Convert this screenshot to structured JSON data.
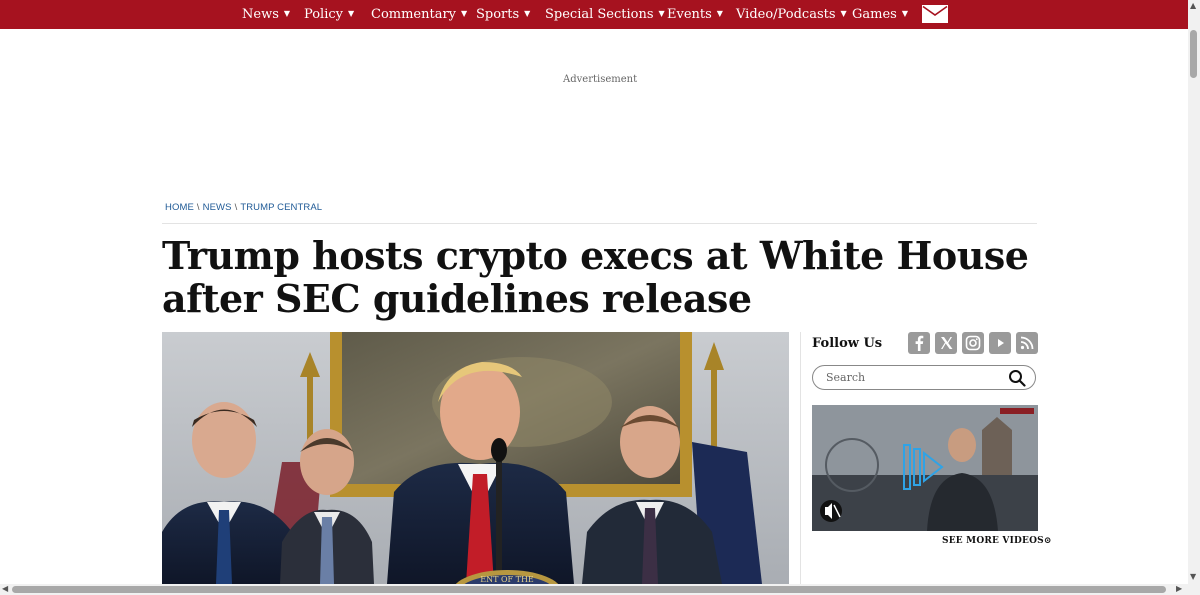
{
  "nav": {
    "items": [
      {
        "label": "News"
      },
      {
        "label": "Policy"
      },
      {
        "label": "Commentary"
      },
      {
        "label": "Sports"
      },
      {
        "label": "Special Sections"
      },
      {
        "label": "Events"
      },
      {
        "label": "Video/Podcasts"
      },
      {
        "label": "Games"
      }
    ],
    "mail_icon": "envelope-icon",
    "bg_color": "#a6121f"
  },
  "ad": {
    "label": "Advertisement"
  },
  "breadcrumb": {
    "home": "HOME",
    "news": "NEWS",
    "section": "TRUMP CENTRAL",
    "separator": "\\"
  },
  "article": {
    "headline": "Trump hosts crypto execs at White House after SEC guidelines release",
    "photo_icon": "article-photo",
    "seal_text": "ENT OF THE"
  },
  "sidebar": {
    "follow_label": "Follow Us",
    "social": [
      {
        "icon": "facebook-icon"
      },
      {
        "icon": "x-icon"
      },
      {
        "icon": "instagram-icon"
      },
      {
        "icon": "youtube-icon"
      },
      {
        "icon": "rss-icon"
      }
    ],
    "search_placeholder": "Search",
    "see_more": "SEE MORE VIDEOS",
    "video_icon": "mute-icon"
  }
}
